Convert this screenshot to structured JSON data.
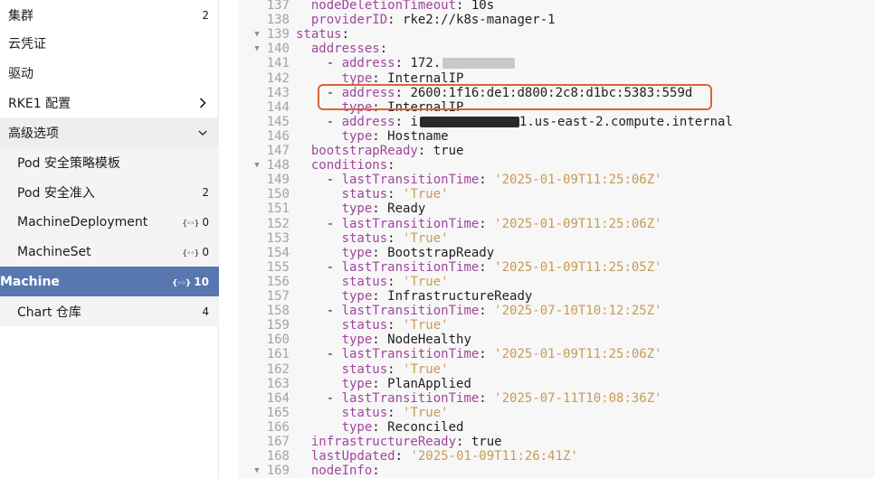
{
  "sidebar": {
    "items": [
      {
        "label": "集群",
        "count": "2",
        "kind": "top"
      },
      {
        "label": "云凭证",
        "count": "",
        "kind": "top"
      },
      {
        "label": "驱动",
        "count": "",
        "kind": "top"
      },
      {
        "label": "RKE1 配置",
        "count": "",
        "kind": "top",
        "chevron": "chevron-right-icon"
      },
      {
        "label": "高级选项",
        "count": "",
        "kind": "group",
        "chevron": "chevron-down-icon"
      },
      {
        "label": "Pod 安全策略模板",
        "count": "",
        "kind": "sub"
      },
      {
        "label": "Pod 安全准入",
        "count": "2",
        "kind": "sub"
      },
      {
        "label": "MachineDeployment",
        "count": "0",
        "kind": "sub",
        "ns": "{◦◦}"
      },
      {
        "label": "MachineSet",
        "count": "0",
        "kind": "sub",
        "ns": "{◦◦}"
      },
      {
        "label": "Machine",
        "count": "10",
        "kind": "active",
        "ns": "{◦◦}"
      },
      {
        "label": "Chart 仓库",
        "count": "4",
        "kind": "sub"
      }
    ]
  },
  "editor": {
    "lines": [
      {
        "n": "137",
        "indent": "  ",
        "key": "nodeDeletionTimeout",
        "val": "10s",
        "vtype": "b"
      },
      {
        "n": "138",
        "indent": "  ",
        "key": "providerID",
        "val": "rke2://k8s-manager-1",
        "vtype": "b"
      },
      {
        "n": "139",
        "indent": "",
        "key": "status",
        "val": "",
        "fold": true
      },
      {
        "n": "140",
        "indent": "  ",
        "key": "addresses",
        "val": "",
        "fold": true
      },
      {
        "n": "141",
        "indent": "    - ",
        "key": "address",
        "val": "172.",
        "vtype": "b",
        "redact": "grey"
      },
      {
        "n": "142",
        "indent": "      ",
        "key": "type",
        "val": "InternalIP",
        "vtype": "b"
      },
      {
        "n": "143",
        "indent": "    - ",
        "key": "address",
        "val": "2600:1f16:de1:d800:2c8:d1bc:5383:559d",
        "vtype": "b"
      },
      {
        "n": "144",
        "indent": "      ",
        "key": "type",
        "val": "InternalIP",
        "vtype": "b"
      },
      {
        "n": "145",
        "indent": "    - ",
        "key": "address",
        "val": "i",
        "vtype": "b",
        "redact": "dark",
        "tail": "1.us-east-2.compute.internal"
      },
      {
        "n": "146",
        "indent": "      ",
        "key": "type",
        "val": "Hostname",
        "vtype": "b"
      },
      {
        "n": "147",
        "indent": "  ",
        "key": "bootstrapReady",
        "val": "true",
        "vtype": "b"
      },
      {
        "n": "148",
        "indent": "  ",
        "key": "conditions",
        "val": "",
        "fold": true
      },
      {
        "n": "149",
        "indent": "    - ",
        "key": "lastTransitionTime",
        "val": "'2025-01-09T11:25:06Z'",
        "vtype": "s"
      },
      {
        "n": "150",
        "indent": "      ",
        "key": "status",
        "val": "'True'",
        "vtype": "s"
      },
      {
        "n": "151",
        "indent": "      ",
        "key": "type",
        "val": "Ready",
        "vtype": "b"
      },
      {
        "n": "152",
        "indent": "    - ",
        "key": "lastTransitionTime",
        "val": "'2025-01-09T11:25:06Z'",
        "vtype": "s"
      },
      {
        "n": "153",
        "indent": "      ",
        "key": "status",
        "val": "'True'",
        "vtype": "s"
      },
      {
        "n": "154",
        "indent": "      ",
        "key": "type",
        "val": "BootstrapReady",
        "vtype": "b"
      },
      {
        "n": "155",
        "indent": "    - ",
        "key": "lastTransitionTime",
        "val": "'2025-01-09T11:25:05Z'",
        "vtype": "s"
      },
      {
        "n": "156",
        "indent": "      ",
        "key": "status",
        "val": "'True'",
        "vtype": "s"
      },
      {
        "n": "157",
        "indent": "      ",
        "key": "type",
        "val": "InfrastructureReady",
        "vtype": "b"
      },
      {
        "n": "158",
        "indent": "    - ",
        "key": "lastTransitionTime",
        "val": "'2025-07-10T10:12:25Z'",
        "vtype": "s"
      },
      {
        "n": "159",
        "indent": "      ",
        "key": "status",
        "val": "'True'",
        "vtype": "s"
      },
      {
        "n": "160",
        "indent": "      ",
        "key": "type",
        "val": "NodeHealthy",
        "vtype": "b"
      },
      {
        "n": "161",
        "indent": "    - ",
        "key": "lastTransitionTime",
        "val": "'2025-01-09T11:25:06Z'",
        "vtype": "s"
      },
      {
        "n": "162",
        "indent": "      ",
        "key": "status",
        "val": "'True'",
        "vtype": "s"
      },
      {
        "n": "163",
        "indent": "      ",
        "key": "type",
        "val": "PlanApplied",
        "vtype": "b"
      },
      {
        "n": "164",
        "indent": "    - ",
        "key": "lastTransitionTime",
        "val": "'2025-07-11T10:08:36Z'",
        "vtype": "s"
      },
      {
        "n": "165",
        "indent": "      ",
        "key": "status",
        "val": "'True'",
        "vtype": "s"
      },
      {
        "n": "166",
        "indent": "      ",
        "key": "type",
        "val": "Reconciled",
        "vtype": "b"
      },
      {
        "n": "167",
        "indent": "  ",
        "key": "infrastructureReady",
        "val": "true",
        "vtype": "b"
      },
      {
        "n": "168",
        "indent": "  ",
        "key": "lastUpdated",
        "val": "'2025-01-09T11:26:41Z'",
        "vtype": "s"
      },
      {
        "n": "169",
        "indent": "  ",
        "key": "nodeInfo",
        "val": "",
        "fold": true
      }
    ]
  },
  "colors": {
    "active_bg": "#5877b1",
    "highlight_border": "#d9633a",
    "yaml_key": "#a1469f",
    "yaml_string": "#c99a52"
  }
}
